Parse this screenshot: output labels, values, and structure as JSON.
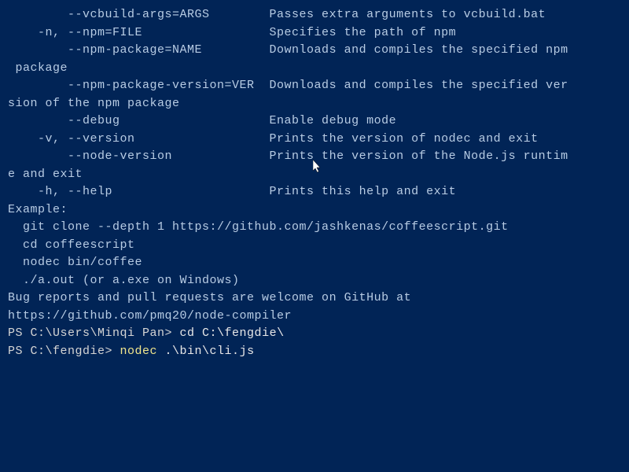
{
  "help_lines": [
    "        --vcbuild-args=ARGS        Passes extra arguments to vcbuild.bat",
    "    -n, --npm=FILE                 Specifies the path of npm",
    "        --npm-package=NAME         Downloads and compiles the specified npm",
    " package",
    "        --npm-package-version=VER  Downloads and compiles the specified ver",
    "sion of the npm package",
    "        --debug                    Enable debug mode",
    "    -v, --version                  Prints the version of nodec and exit",
    "        --node-version             Prints the version of the Node.js runtim",
    "e and exit",
    "    -h, --help                     Prints this help and exit",
    "",
    "Example:",
    "  git clone --depth 1 https://github.com/jashkenas/coffeescript.git",
    "  cd coffeescript",
    "  nodec bin/coffee",
    "  ./a.out (or a.exe on Windows)",
    "",
    "Bug reports and pull requests are welcome on GitHub at",
    "https://github.com/pmq20/node-compiler"
  ],
  "prompt1": {
    "ps": "PS C:\\Users\\Minqi Pan> ",
    "cmd": "cd C:\\fengdie\\"
  },
  "prompt2": {
    "ps": "PS C:\\fengdie> ",
    "cmd_yellow": "nodec",
    "cmd_white": " .\\bin\\cli.js"
  }
}
